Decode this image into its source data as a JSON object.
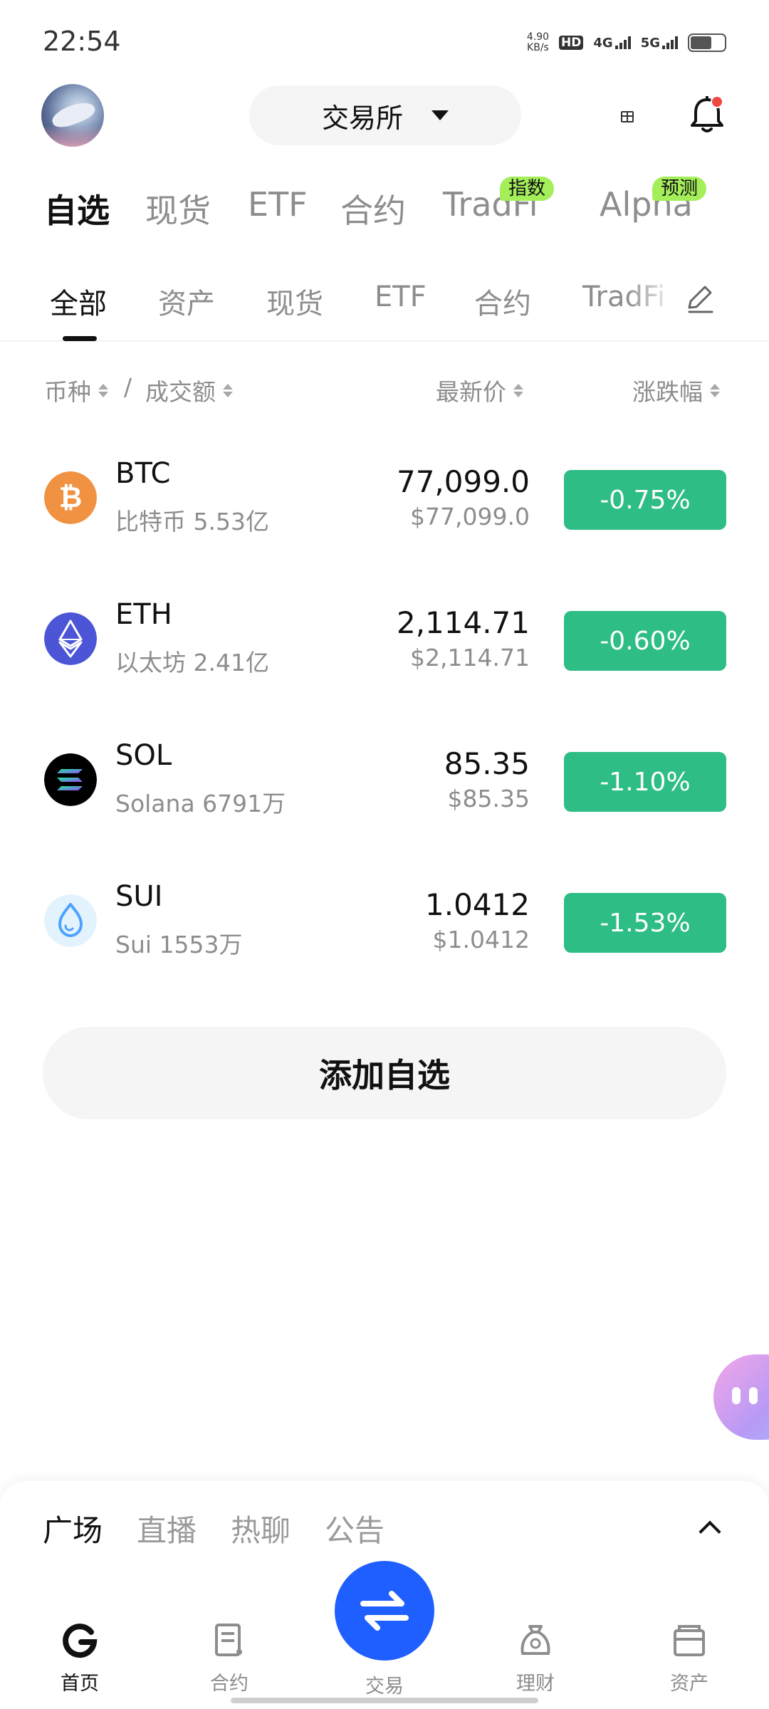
{
  "status_bar": {
    "time": "22:54",
    "net_speed_value": "4.90",
    "net_speed_unit": "KB/s",
    "hd_label": "HD",
    "sim1_label": "4G",
    "sim2_label": "5G",
    "battery_level": 0.62
  },
  "header": {
    "exchange_label": "交易所"
  },
  "main_tabs": [
    {
      "label": "自选",
      "active": true,
      "badge": ""
    },
    {
      "label": "现货",
      "active": false,
      "badge": ""
    },
    {
      "label": "ETF",
      "active": false,
      "badge": ""
    },
    {
      "label": "合约",
      "active": false,
      "badge": ""
    },
    {
      "label": "TradFi",
      "active": false,
      "badge": "指数"
    },
    {
      "label": "Alpha",
      "active": false,
      "badge": "预测"
    }
  ],
  "sub_tabs": [
    {
      "label": "全部",
      "active": true
    },
    {
      "label": "资产",
      "active": false
    },
    {
      "label": "现货",
      "active": false
    },
    {
      "label": "ETF",
      "active": false
    },
    {
      "label": "合约",
      "active": false
    },
    {
      "label": "TradFi",
      "active": false
    }
  ],
  "list_header": {
    "coin": "币种",
    "separator": "/",
    "volume": "成交额",
    "price": "最新价",
    "change": "涨跌幅"
  },
  "coins": [
    {
      "symbol": "BTC",
      "sub": "比特币 5.53亿",
      "price": "77,099.0",
      "usd": "$77,099.0",
      "change": "-0.75%",
      "icon": "btc-icon"
    },
    {
      "symbol": "ETH",
      "sub": "以太坊 2.41亿",
      "price": "2,114.71",
      "usd": "$2,114.71",
      "change": "-0.60%",
      "icon": "eth-icon"
    },
    {
      "symbol": "SOL",
      "sub": "Solana 6791万",
      "price": "85.35",
      "usd": "$85.35",
      "change": "-1.10%",
      "icon": "sol-icon"
    },
    {
      "symbol": "SUI",
      "sub": "Sui 1553万",
      "price": "1.0412",
      "usd": "$1.0412",
      "change": "-1.53%",
      "icon": "sui-icon"
    }
  ],
  "add_watchlist_label": "添加自选",
  "bottom_panel": {
    "tabs": [
      {
        "label": "广场",
        "active": true
      },
      {
        "label": "直播",
        "active": false
      },
      {
        "label": "热聊",
        "active": false
      },
      {
        "label": "公告",
        "active": false
      }
    ]
  },
  "bottom_nav": {
    "home": "首页",
    "futures": "合约",
    "trade": "交易",
    "earn": "理财",
    "assets": "资产"
  },
  "colors": {
    "up_down_badge": "#2ebd85",
    "tab_badge": "#a4ee5a",
    "trade_button": "#1f5fff",
    "notification_dot": "#f0483e"
  }
}
